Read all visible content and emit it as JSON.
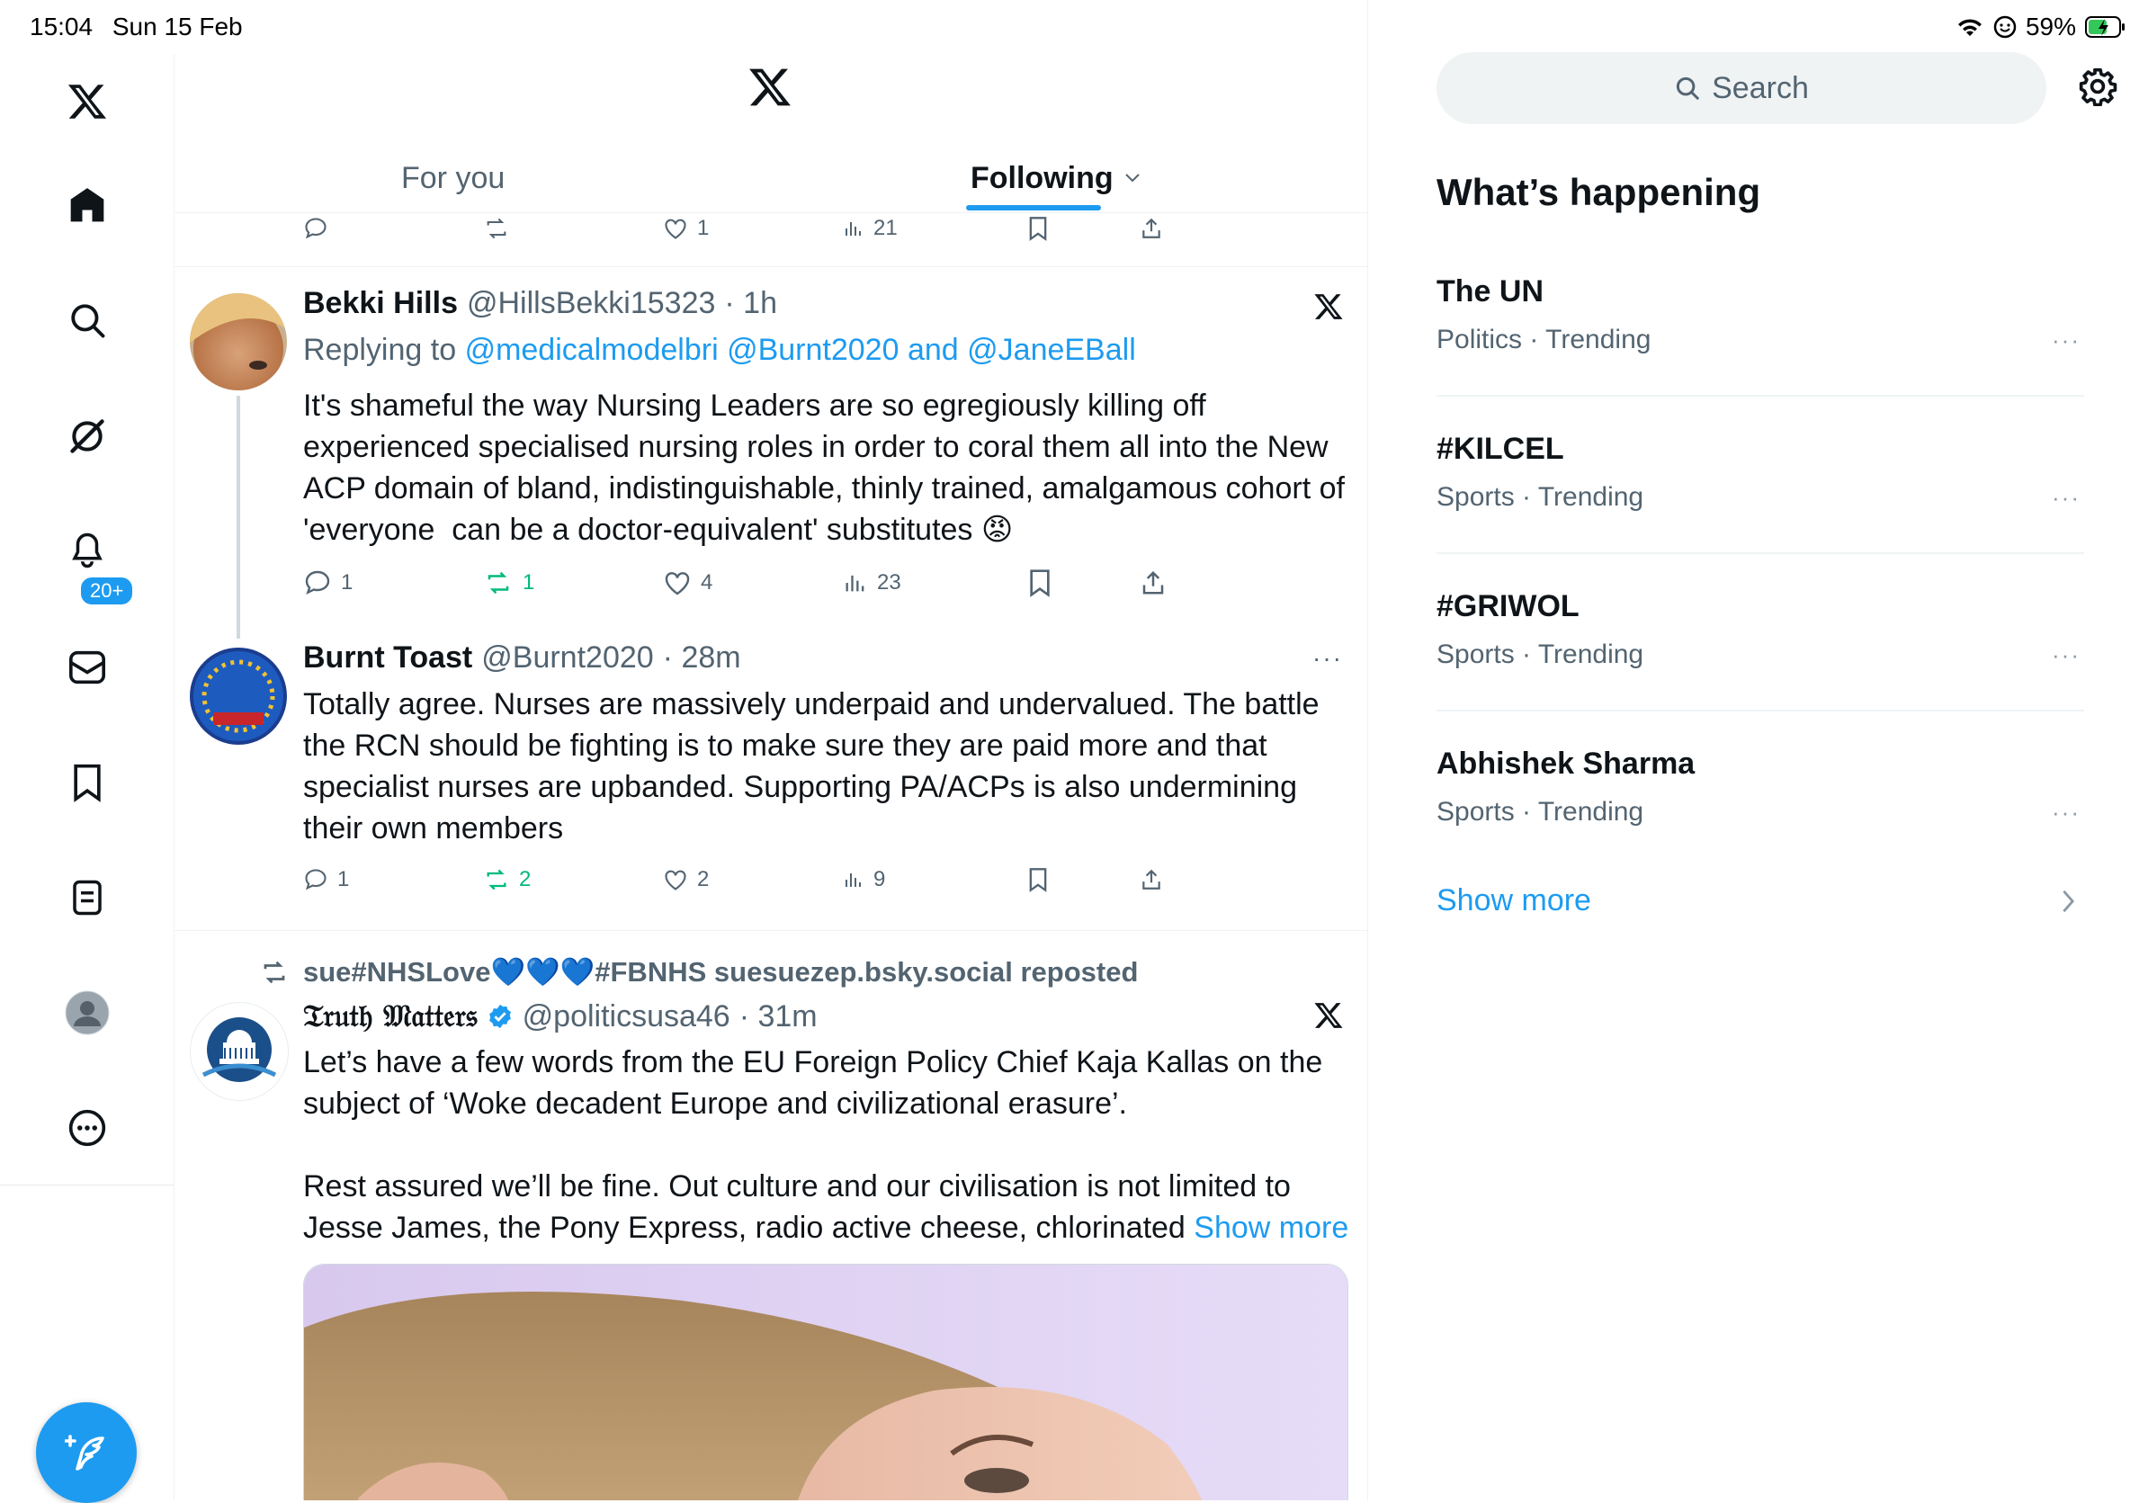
{
  "status_bar": {
    "time": "15:04",
    "date": "Sun 15 Feb",
    "battery": "59%"
  },
  "sidebar": {
    "items": [
      {
        "name": "x-logo-icon"
      },
      {
        "name": "home-icon"
      },
      {
        "name": "search-icon"
      },
      {
        "name": "grok-icon"
      },
      {
        "name": "notifications-icon"
      },
      {
        "name": "messages-icon"
      },
      {
        "name": "bookmarks-icon"
      },
      {
        "name": "lists-icon"
      },
      {
        "name": "profile-icon"
      },
      {
        "name": "more-icon"
      }
    ],
    "notifications_badge": "20+"
  },
  "header": {
    "tabs": [
      {
        "label": "For you",
        "active": false
      },
      {
        "label": "Following",
        "active": true
      }
    ]
  },
  "previous_tweet_actions": {
    "replies": "",
    "reposts": "",
    "likes": "1",
    "views": "21"
  },
  "tweets": [
    {
      "name": "Bekki Hills",
      "handle": "@HillsBekki15323",
      "time": "· 1h",
      "replying_prefix": "Replying to",
      "replying_to": "@medicalmodelbri @Burnt2020",
      "replying_and": "and",
      "replying_last": "@JaneEBall",
      "text": "It's shameful the way Nursing Leaders are so egregiously killing off experienced specialised nursing roles in order to coral them all into the New ACP domain of bland, indistinguishable, thinly trained, amalgamous cohort of 'everyone  can be a doctor-equivalent' substitutes 😡",
      "replies": "1",
      "reposts": "1",
      "likes": "4",
      "views": "23"
    },
    {
      "name": "Burnt Toast",
      "handle": "@Burnt2020",
      "time": "· 28m",
      "text": "Totally agree. Nurses are massively underpaid and undervalued. The battle the RCN should be fighting is to make sure they are paid more and that specialist nurses are upbanded. Supporting PA/ACPs is also undermining their own members",
      "replies": "1",
      "reposts": "2",
      "likes": "2",
      "views": "9"
    },
    {
      "reposted_by": "sue#NHSLove💙💙💙#FBNHS suesuezep.bsky.social reposted",
      "name": "𝔗𝔯𝔲𝔱𝔥 𝔐𝔞𝔱𝔱𝔢𝔯𝔰",
      "handle": "@politicsusa46",
      "time": "· 31m",
      "text": "Let’s have a few words from the EU Foreign Policy Chief Kaja Kallas on the subject of ‘Woke decadent Europe and civilizational erasure’.\n\nRest assured we’ll be fine. Out culture and our civilisation is not limited to Jesse James, the Pony Express, radio active cheese, chlorinated",
      "show_more": "Show more"
    }
  ],
  "right": {
    "search_placeholder": "Search",
    "section_title": "What’s happening",
    "trends": [
      {
        "name": "The UN",
        "meta": "Politics · Trending"
      },
      {
        "name": "#KILCEL",
        "meta": "Sports · Trending"
      },
      {
        "name": "#GRIWOL",
        "meta": "Sports · Trending"
      },
      {
        "name": "Abhishek Sharma",
        "meta": "Sports · Trending"
      }
    ],
    "show_more": "Show more"
  },
  "colors": {
    "accent": "#1d9bf0",
    "repost_green": "#00ba7c",
    "muted": "#536471"
  }
}
